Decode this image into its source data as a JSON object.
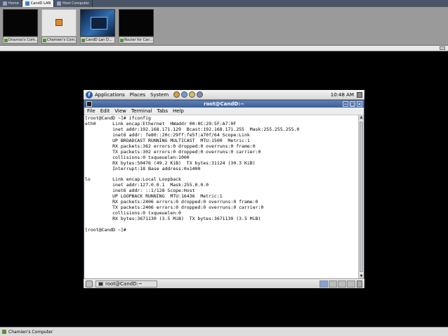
{
  "tabs": [
    {
      "label": "Home",
      "icon": "home-icon"
    },
    {
      "label": "CandD LAN",
      "icon": "network-icon",
      "active": true
    },
    {
      "label": "Host Computer",
      "icon": "computer-icon"
    }
  ],
  "thumbnails": [
    {
      "label": "Dravnos's Com..."
    },
    {
      "label": "Chamien's Com..."
    },
    {
      "label": "CandD Lan D..."
    },
    {
      "label": "Router for Can..."
    }
  ],
  "gnome_panel": {
    "menus": [
      "Applications",
      "Places",
      "System"
    ],
    "time": "10:48 AM"
  },
  "terminal": {
    "title": "root@CandD:~",
    "menu": [
      "File",
      "Edit",
      "View",
      "Terminal",
      "Tabs",
      "Help"
    ],
    "lines": [
      "[root@CandD ~]# ifconfig",
      "eth0      Link encap:Ethernet  HWaddr 00:0C:29:5F:A7:0F",
      "          inet addr:192.168.171.129  Bcast:192.168.171.255  Mask:255.255.255.0",
      "          inet6 addr: fe80::20c:29ff:fe5f:a70f/64 Scope:Link",
      "          UP BROADCAST RUNNING MULTICAST  MTU:1500  Metric:1",
      "          RX packets:362 errors:0 dropped:0 overruns:0 frame:0",
      "          TX packets:302 errors:0 dropped:0 overruns:0 carrier:0",
      "          collisions:0 txqueuelen:1000",
      "          RX bytes:50476 (49.2 KiB)  TX bytes:31124 (30.3 KiB)",
      "          Interrupt:18 Base address:0x1400",
      "",
      "lo        Link encap:Local Loopback",
      "          inet addr:127.0.0.1  Mask:255.0.0.0",
      "          inet6 addr: ::1/128 Scope:Host",
      "          UP LOOPBACK RUNNING  MTU:16436  Metric:1",
      "          RX packets:2406 errors:0 dropped:0 overruns:0 frame:0",
      "          TX packets:2406 errors:0 dropped:0 overruns:0 carrier:0",
      "          collisions:0 txqueuelen:0",
      "          RX bytes:3671130 (3.5 MiB)  TX bytes:3671130 (3.5 MiB)",
      "",
      "[root@CandD ~]# "
    ]
  },
  "taskbar": {
    "task_label": "root@CandD:~"
  },
  "statusbar": {
    "label": "Chamien's Computer"
  }
}
